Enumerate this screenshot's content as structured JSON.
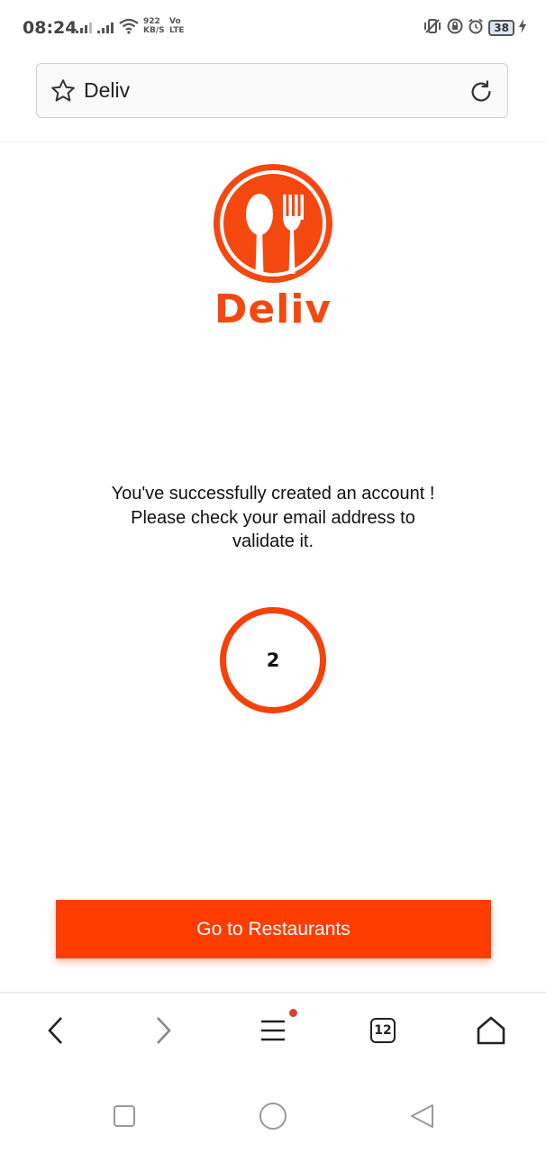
{
  "status_bar": {
    "time": "08:24",
    "speed_value": "922",
    "speed_unit": "KB/S",
    "volte_top": "Vo",
    "volte_bottom": "LTE",
    "battery": "38"
  },
  "url_bar": {
    "site_title": "Deliv"
  },
  "logo": {
    "text": "Deliv",
    "color": "#f44810"
  },
  "message": {
    "line1": "You've successfully created an account !",
    "line2": "Please check your email address to validate it."
  },
  "countdown": {
    "value": "2"
  },
  "cta": {
    "label": "Go to Restaurants",
    "color": "#ff3d00"
  },
  "browser_toolbar": {
    "tabs_count": "12",
    "items": [
      "back-icon",
      "forward-icon",
      "menu-icon",
      "tabs-icon",
      "home-icon"
    ]
  },
  "android_nav": {
    "items": [
      "recents-icon",
      "home-circle-icon",
      "back-triangle-icon"
    ]
  }
}
